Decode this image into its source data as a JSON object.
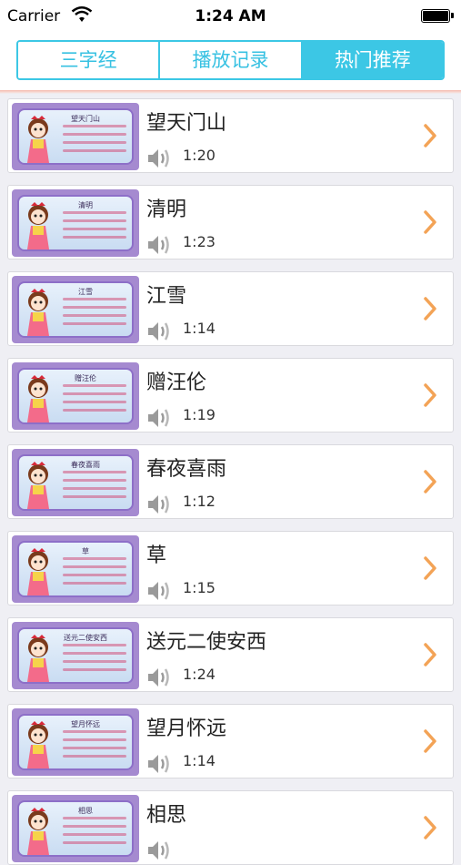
{
  "status": {
    "carrier": "Carrier",
    "time": "1:24 AM"
  },
  "tabs": [
    {
      "label": "三字经",
      "active": false
    },
    {
      "label": "播放记录",
      "active": false
    },
    {
      "label": "热门推荐",
      "active": true
    }
  ],
  "items": [
    {
      "title": "望天门山",
      "duration": "1:20",
      "thumb_title": "望天门山"
    },
    {
      "title": "清明",
      "duration": "1:23",
      "thumb_title": "清明"
    },
    {
      "title": "江雪",
      "duration": "1:14",
      "thumb_title": "江雪"
    },
    {
      "title": "赠汪伦",
      "duration": "1:19",
      "thumb_title": "赠汪伦"
    },
    {
      "title": "春夜喜雨",
      "duration": "1:12",
      "thumb_title": "春夜喜雨"
    },
    {
      "title": "草",
      "duration": "1:15",
      "thumb_title": "草"
    },
    {
      "title": "送元二使安西",
      "duration": "1:24",
      "thumb_title": "送元二使安西"
    },
    {
      "title": "望月怀远",
      "duration": "1:14",
      "thumb_title": "望月怀远"
    },
    {
      "title": "相思",
      "duration": "",
      "thumb_title": "相思"
    }
  ],
  "colors": {
    "accent": "#3cc7e5",
    "chevron": "#f3a356"
  },
  "icons": {
    "wifi": "wifi-icon",
    "battery": "battery-icon",
    "speaker": "speaker-icon",
    "chevron": "chevron-right-icon"
  }
}
